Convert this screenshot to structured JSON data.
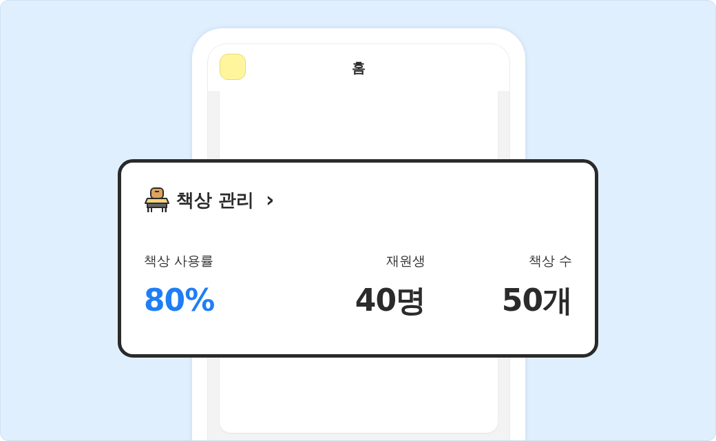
{
  "phone": {
    "title": "홈"
  },
  "card": {
    "title": "책상 관리",
    "chevron": "›",
    "stats": [
      {
        "label": "책상 사용률",
        "value": "80%",
        "color": "#1f7ef5"
      },
      {
        "label": "재원생",
        "value": "40명",
        "color": "#2b2b2b"
      },
      {
        "label": "책상 수",
        "value": "50개",
        "color": "#2b2b2b"
      }
    ]
  }
}
